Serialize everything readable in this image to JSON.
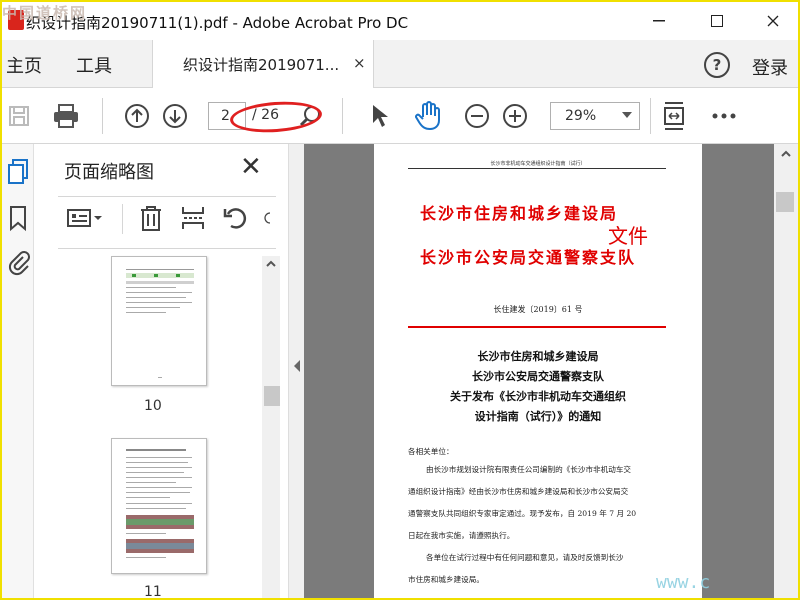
{
  "window": {
    "title": "织设计指南20190711(1).pdf - Adobe Acrobat Pro DC",
    "watermark": "中国道桥网"
  },
  "menu": {
    "home": "主页",
    "tools": "工具",
    "login": "登录"
  },
  "tab": {
    "label": "织设计指南2019071...",
    "close": "×"
  },
  "toolbar": {
    "current_page": "2",
    "total_pages": "/ 26",
    "zoom": "29%"
  },
  "thumbnails": {
    "title": "页面缩略图",
    "close": "✕",
    "pages": [
      {
        "number": "10"
      },
      {
        "number": "11"
      }
    ]
  },
  "document": {
    "header": "长沙市非机动车交通组织设计指南（试行）",
    "org_1": "长沙市住房和城乡建设局",
    "org_2": "长沙市公安局交通警察支队",
    "doc_type": "文件",
    "doc_number": "长住建发〔2019〕61 号",
    "notice_title": [
      "长沙市住房和城乡建设局",
      "长沙市公安局交通警察支队",
      "关于发布《长沙市非机动车交通组织",
      "设计指南（试行）》的通知"
    ],
    "body": [
      "各相关单位：",
      "由长沙市规划设计院有限责任公司编制的《长沙市非机动车交",
      "通组织设计指南》经由长沙市住房和城乡建设局和长沙市公安局交",
      "通警察支队共同组织专家审定通过。现予发布，自 2019 年 7 月 20",
      "日起在我市实施，请遵照执行。",
      "各单位在试行过程中有任何问题和意见，请及时反馈到长沙",
      "市住房和城乡建设局。"
    ]
  },
  "site_watermark": "www.c"
}
